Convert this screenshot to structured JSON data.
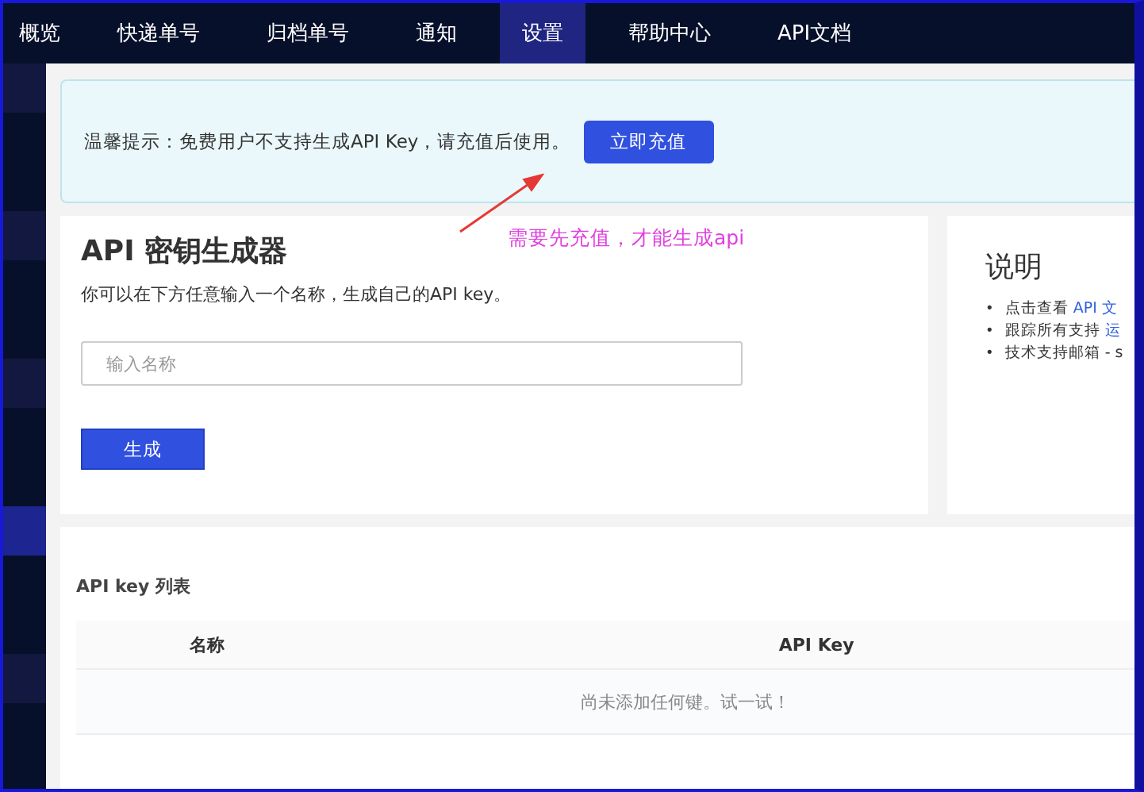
{
  "nav": {
    "items": [
      {
        "label": "概览",
        "selected": false
      },
      {
        "label": "快递单号",
        "selected": false
      },
      {
        "label": "归档单号",
        "selected": false
      },
      {
        "label": "通知",
        "selected": false
      },
      {
        "label": "设置",
        "selected": true
      },
      {
        "label": "帮助中心",
        "selected": false
      },
      {
        "label": "API文档",
        "selected": false
      }
    ]
  },
  "sidebar": {
    "items": [
      {
        "selected": false
      },
      {
        "selected": false
      },
      {
        "selected": false
      },
      {
        "selected": false
      },
      {
        "selected": false
      },
      {
        "selected": false
      },
      {
        "selected": false
      },
      {
        "selected": false
      },
      {
        "selected": false
      },
      {
        "selected": true
      },
      {
        "selected": false
      },
      {
        "selected": false
      },
      {
        "selected": false
      },
      {
        "selected": false
      },
      {
        "selected": false
      }
    ]
  },
  "notice": {
    "text": "温馨提示：免费用户不支持生成API Key，请充值后使用。",
    "button": "立即充值"
  },
  "annotation": {
    "text": "需要先充值，才能生成api"
  },
  "generator": {
    "title": "API 密钥生成器",
    "description": "你可以在下方任意输入一个名称，生成自己的API key。",
    "name_field": {
      "placeholder": "输入名称"
    },
    "button": "生成"
  },
  "info": {
    "title": "说明",
    "items": [
      {
        "bullet": "•",
        "text": "点击查看 ",
        "link": "API 文"
      },
      {
        "bullet": "•",
        "text": "跟踪所有支持 ",
        "link": "运"
      },
      {
        "bullet": "•",
        "text": "技术支持邮箱 - s"
      }
    ]
  },
  "key_list": {
    "title": "API key 列表",
    "columns": [
      "名称",
      "API Key"
    ],
    "empty_text": "尚未添加任何键。试一试！"
  }
}
